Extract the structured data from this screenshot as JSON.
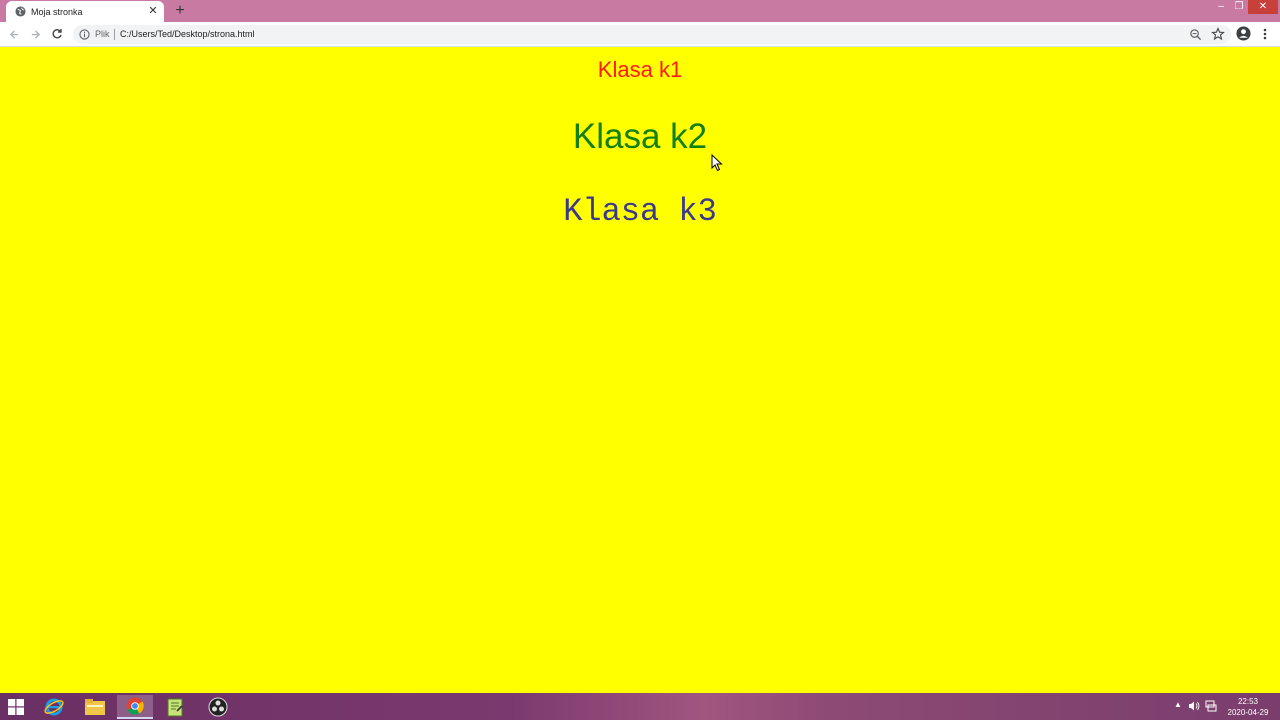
{
  "browser": {
    "tab": {
      "title": "Moja stronka",
      "close_glyph": "✕",
      "favicon": "globe-icon"
    },
    "new_tab_glyph": "+",
    "window_controls": {
      "minimize": "–",
      "maximize": "❐",
      "close": "✕"
    },
    "address_bar": {
      "scheme_label": "Plik",
      "url": "C:/Users/Ted/Desktop/strona.html"
    }
  },
  "page": {
    "background": "#ffff00",
    "k1": {
      "text": "Klasa k1",
      "color": "#ff1a1a"
    },
    "k2": {
      "text": "Klasa k2",
      "color": "#128012"
    },
    "k3": {
      "text": "Klasa k3",
      "color": "#3a3a8a"
    }
  },
  "taskbar": {
    "apps": [
      "start-icon",
      "internet-explorer-icon",
      "file-explorer-icon",
      "chrome-icon",
      "notepad-plus-icon",
      "obs-icon"
    ],
    "active_app": "chrome-icon",
    "clock": {
      "time": "22:53",
      "date": "2020-04-29"
    },
    "tray_chevron": "▲"
  }
}
